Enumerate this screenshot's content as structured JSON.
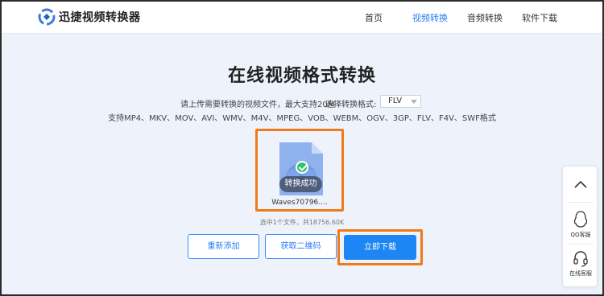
{
  "app": {
    "name": "迅捷视频转换器"
  },
  "nav": {
    "items": [
      {
        "label": "首页",
        "active": false
      },
      {
        "label": "视频转换",
        "active": true
      },
      {
        "label": "音频转换",
        "active": false
      },
      {
        "label": "软件下载",
        "active": false
      }
    ]
  },
  "main": {
    "title": "在线视频格式转换",
    "upload_hint": "请上传需要转换的视频文件，最大支持20M",
    "format_label": "选择转换格式:",
    "format_selected": "FLV",
    "supported_formats": "支持MP4、MKV、MOV、AVI、WMV、M4V、MPEG、VOB、WEBM、OGV、3GP、FLV、F4V、SWF格式"
  },
  "file": {
    "name": "Waves70796....",
    "status": "转换成功",
    "summary": "选中1个文件，共18756.60K"
  },
  "buttons": {
    "re_add": "重新添加",
    "qr_code": "获取二维码",
    "download": "立即下载"
  },
  "side_panel": {
    "qq_label": "QQ客服",
    "online_label": "在线客服"
  },
  "colors": {
    "accent": "#2a7cf6",
    "primary_button": "#1d86f4",
    "highlight_border": "#f07a1a",
    "success": "#2fc36f",
    "background": "#eef3fb"
  }
}
